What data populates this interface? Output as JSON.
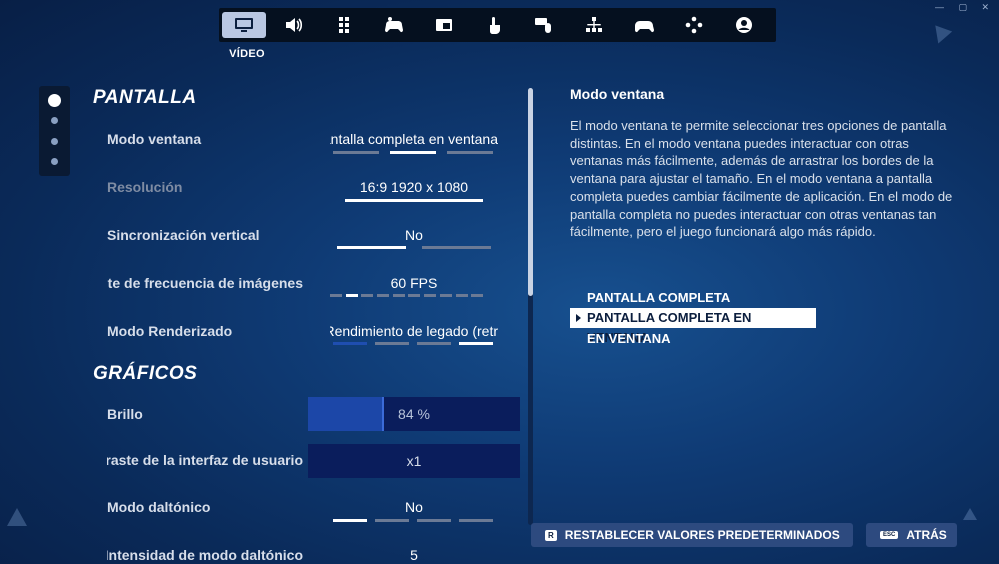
{
  "nav": {
    "tabs": [
      {
        "icon": "monitor-icon",
        "active": true
      },
      {
        "icon": "speaker-icon"
      },
      {
        "icon": "keyboard-grid-icon"
      },
      {
        "icon": "gamepad-touch-icon"
      },
      {
        "icon": "window-icon"
      },
      {
        "icon": "touch-hand-icon"
      },
      {
        "icon": "keyboard-mouse-icon"
      },
      {
        "icon": "network-icon"
      },
      {
        "icon": "controller-icon"
      },
      {
        "icon": "dpad-icon"
      },
      {
        "icon": "account-icon"
      }
    ],
    "active_label": "VÍDEO"
  },
  "window_controls": "— ▢ ✕",
  "left": {
    "section_display": "PANTALLA",
    "section_graphics": "GRÁFICOS",
    "rows": {
      "window_mode": {
        "label": "Modo ventana",
        "value": "Pantalla completa en ventana",
        "segments": 3,
        "selected": 1
      },
      "resolution": {
        "label": "Resolución",
        "value": "16:9 1920 x 1080"
      },
      "vsync": {
        "label": "Sincronización vertical",
        "value": "No",
        "segments": 2,
        "selected": 0
      },
      "fps_limit": {
        "label": "Límite de frecuencia de imágenes",
        "value": "60 FPS",
        "segments": 10,
        "selected": 1
      },
      "render_mode": {
        "label": "Modo Renderizado",
        "value": "Rendimiento de legado (retr",
        "segments": 4,
        "selected": 3
      },
      "brightness": {
        "label": "Brillo",
        "value": "84 %",
        "level": 0.35
      },
      "ui_contrast": {
        "label": "Contraste de la interfaz de usuario",
        "value": "x1"
      },
      "colorblind_mode": {
        "label": "Modo daltónico",
        "value": "No",
        "segments": 4,
        "selected": 0
      },
      "colorblind_intensity": {
        "label": "Intensidad de modo daltónico",
        "value": "5"
      }
    }
  },
  "right": {
    "title": "Modo ventana",
    "description": "El modo ventana te permite seleccionar tres opciones de pantalla distintas. En el modo ventana puedes interactuar con otras ventanas más fácilmente, además de arrastrar los bordes de la ventana para ajustar el tamaño. En el modo ventana a pantalla completa puedes cambiar fácilmente de aplicación. En el modo de pantalla completa no puedes interactuar con otras ventanas tan fácilmente, pero el juego funcionará algo más rápido.",
    "options": [
      "PANTALLA COMPLETA",
      "PANTALLA COMPLETA EN VENTANA",
      "EN VENTANA"
    ],
    "selected_option": 1
  },
  "footer": {
    "reset_key": "R",
    "reset_label": "RESTABLECER VALORES PREDETERMINADOS",
    "back_key": "ESC",
    "back_label": "ATRÁS"
  },
  "colors": {
    "accent": "#1c47a8",
    "selected_bg": "#ffffff",
    "nav_active": "#b9c7e2"
  }
}
